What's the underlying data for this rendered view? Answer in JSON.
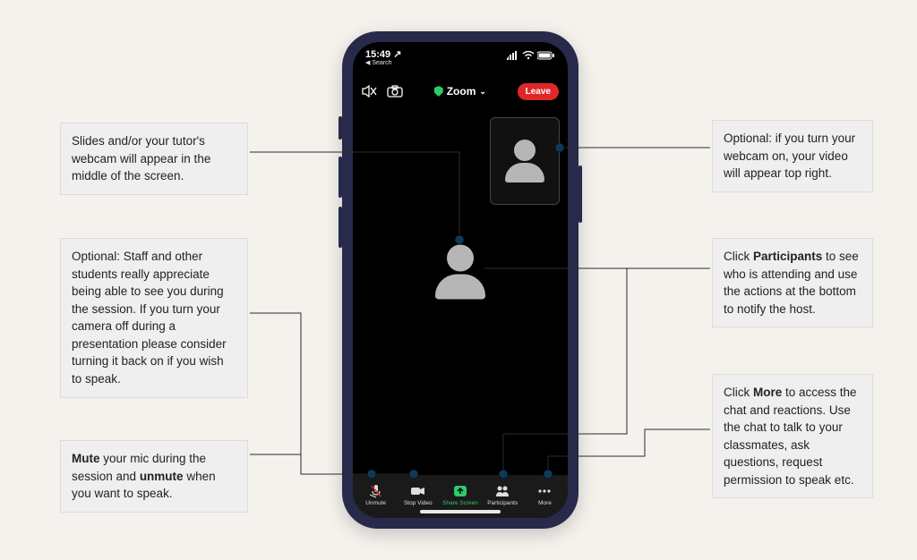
{
  "status": {
    "time": "15:49 ↗",
    "sub": "◀ Search"
  },
  "appbar": {
    "title": "Zoom",
    "leave": "Leave"
  },
  "bottom": {
    "unmute": "Unmute",
    "stopvideo": "Stop Video",
    "sharescreen": "Share Screen",
    "participants": "Participants",
    "more": "More"
  },
  "callouts": {
    "slides": "Slides and/or your tutor's webcam will appear in the middle of the screen.",
    "staff": "Optional: Staff and other students really appreciate being able to see you during the session. If you turn your camera off during a presentation please consider turning it back on if you wish to speak.",
    "mute_pre": "Mute",
    "mute_mid": " your mic during the session and ",
    "mute_bold2": "unmute",
    "mute_post": " when you want to speak.",
    "webcam": "Optional: if you turn your webcam on, your video will appear top right.",
    "participants_pre": "Click ",
    "participants_bold": "Participants",
    "participants_post": " to see who is attending and use the actions at the bottom to notify the host.",
    "more_pre": "Click ",
    "more_bold": "More",
    "more_post": " to access the chat and reactions. Use the chat to talk to your classmates, ask questions, request permission to speak etc."
  }
}
